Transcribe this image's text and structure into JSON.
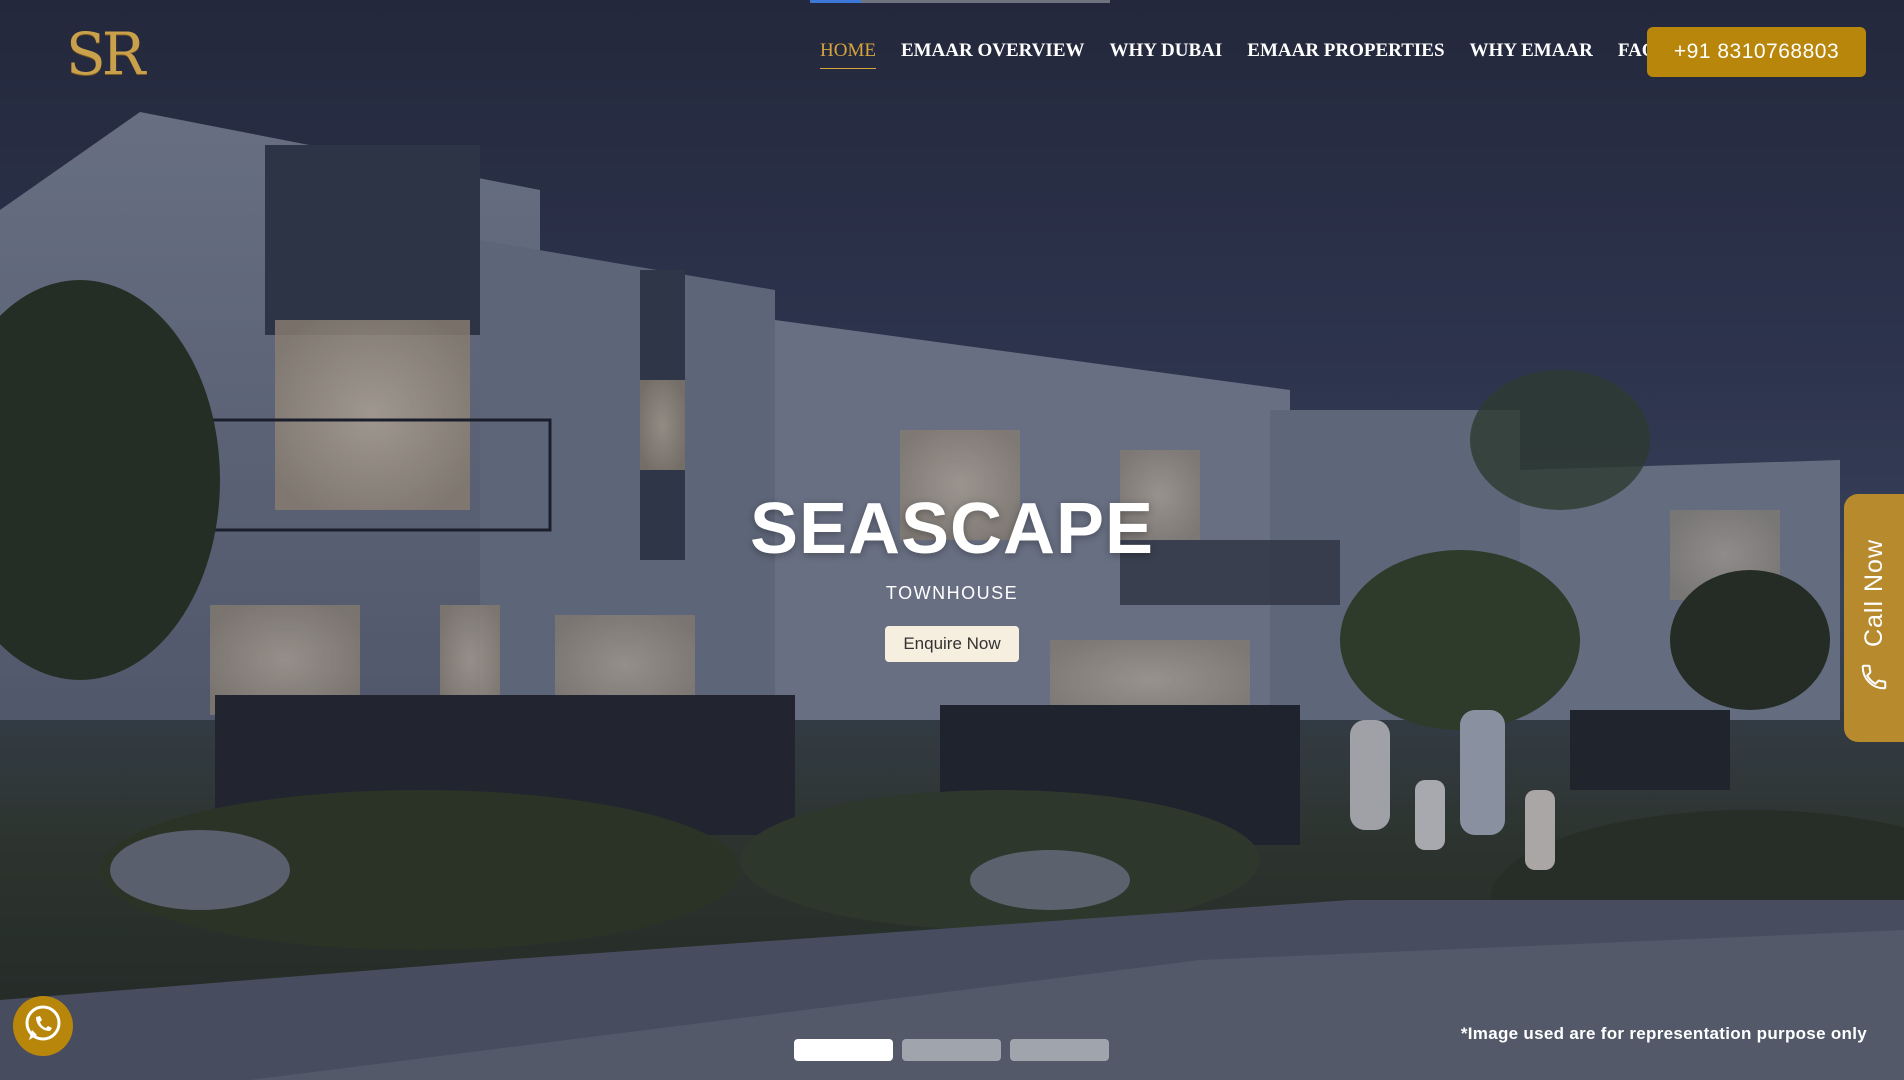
{
  "header": {
    "logo_text": "SR",
    "nav": [
      {
        "label": "HOME",
        "active": true
      },
      {
        "label": "EMAAR OVERVIEW",
        "active": false
      },
      {
        "label": "WHY DUBAI",
        "active": false
      },
      {
        "label": "EMAAR PROPERTIES",
        "active": false
      },
      {
        "label": "WHY EMAAR",
        "active": false
      },
      {
        "label": "FAQ",
        "active": false
      }
    ],
    "phone_button": "+91 8310768803"
  },
  "hero": {
    "title": "SEASCAPE",
    "subtitle": "TOWNHOUSE",
    "cta": "Enquire Now",
    "disclaimer": "*Image used are for representation purpose only"
  },
  "slider": {
    "slide_count": 3,
    "active_index": 0,
    "progress_fraction": 0.17
  },
  "floating": {
    "call_now_label": "Call Now",
    "call_icon": "phone-icon",
    "whatsapp_icon": "whatsapp-icon"
  },
  "colors": {
    "accent_gold": "#b8860b",
    "nav_active": "#d4a53c",
    "progress_blue": "#3b78d8"
  }
}
